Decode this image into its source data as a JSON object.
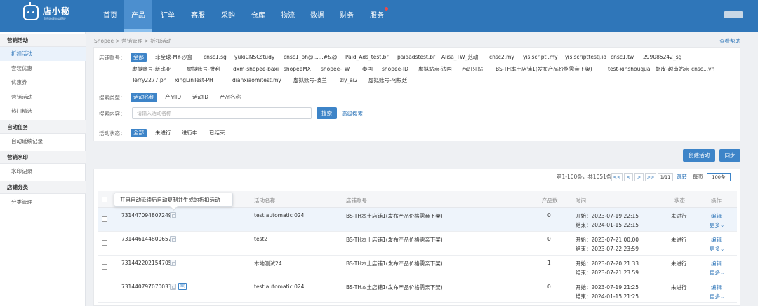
{
  "app": {
    "brand": "店小秘",
    "brand_sub": "免费跨境电商ERP",
    "user": "...."
  },
  "nav": {
    "items": [
      "首页",
      "产品",
      "订单",
      "客服",
      "采购",
      "仓库",
      "物流",
      "数据",
      "财务",
      "服务"
    ],
    "active": "产品"
  },
  "sidebar": {
    "groups": [
      {
        "title": "营销活动",
        "items": [
          "折扣活动",
          "套装优惠",
          "优惠券",
          "营销活动",
          "热门精选"
        ]
      },
      {
        "title": "自动任务",
        "items": [
          "自动延续记录"
        ]
      },
      {
        "title": "营销水印",
        "items": [
          "水印记录"
        ]
      },
      {
        "title": "店铺分类",
        "items": [
          "分类管理"
        ]
      }
    ],
    "active": "折扣活动"
  },
  "breadcrumb": "Shopee > 营销管理 > 折扣活动",
  "help": "查看帮助",
  "filters": {
    "shop_label": "店铺账号：",
    "shops_row1": [
      "全部",
      "菲全球-MY-沙盒",
      "cnsc1.sg",
      "yukiCNSCstudy",
      "cnsc1_ph@......#&@",
      "Paid_Ads_test.br",
      "paidadstest.br",
      "Alisa_TW_范动",
      "cnsc2.my",
      "yisiscripti.my",
      "yisiscripttestj.id",
      "cnsc1.tw",
      "299085242_sg"
    ],
    "shops_row2": [
      "虚拟账号-新比亚",
      "虚拟账号-誉利",
      "dxm-shopee-baxi",
      "shopeeMX",
      "shopee-TW",
      "泰国",
      "shopee-ID",
      "虚拟站点-法国",
      "西班牙站",
      "BS-TH本土店铺1(发布产品价格需亲下架)",
      "test-xinshouqua",
      "虾皮-越南站点",
      "cnsc1.vn"
    ],
    "shops_row3": [
      "Terry2277.ph",
      "xingLinTest-PH",
      "dianxiaomitest.my",
      "虚拟账号-波兰",
      "zly_ai2",
      "虚拟账号-阿根廷"
    ],
    "type_label": "搜索类型：",
    "types": [
      "活动名称",
      "产品ID",
      "活动ID",
      "产品名称"
    ],
    "content_label": "搜索内容：",
    "search_placeholder": "请输入活动名称",
    "search_button": "搜索",
    "advanced": "高级搜索",
    "status_label": "活动状态：",
    "statuses": [
      "全部",
      "未进行",
      "进行中",
      "已结束"
    ]
  },
  "actions": {
    "create": "创建活动",
    "sync": "同步"
  },
  "pager": {
    "summary": "第1-100条，共1051条",
    "prev2": "<<",
    "prev": "<",
    "next": ">",
    "next2": ">>",
    "pages": "1/11",
    "jump": "跳转",
    "per_page_label": "每页",
    "per_page": "100条"
  },
  "table": {
    "headers": [
      "活动名称",
      "店铺账号",
      "产品数",
      "时间",
      "状态",
      "操作"
    ],
    "tooltip": "开启自动延续后自动复制并生成的折扣活动",
    "rows": [
      {
        "id": "731447094807249",
        "name": "test automatic 024",
        "shop": "BS-TH本土店铺1(发布产品价格需亲下架)",
        "count": "0",
        "start": "开始：2023-07-19 22:15",
        "end": "结束：2024-01-15 22:15",
        "status": "未进行",
        "edit": "编辑",
        "more": "更多⌄"
      },
      {
        "id": "731446144800657",
        "name": "test2",
        "shop": "BS-TH本土店铺1(发布产品价格需亲下架)",
        "count": "0",
        "start": "开始：2023-07-21 00:00",
        "end": "结束：2023-07-22 23:59",
        "status": "未进行",
        "edit": "编辑",
        "more": "更多⌄"
      },
      {
        "id": "731442202154705",
        "name": "本地测试24",
        "shop": "BS-TH本土店铺1(发布产品价格需亲下架)",
        "count": "1",
        "start": "开始：2023-07-20 21:33",
        "end": "结束：2023-07-21 23:59",
        "status": "未进行",
        "edit": "编辑",
        "more": "更多⌄"
      },
      {
        "id": "731440797070033",
        "name": "test automatic 024",
        "shop": "BS-TH本土店铺1(发布产品价格需亲下架)",
        "count": "0",
        "start": "开始：2023-07-19 21:25",
        "end": "结束：2024-01-15 21:25",
        "status": "未进行",
        "edit": "编辑",
        "more": "更多⌄",
        "tag": "续"
      }
    ]
  }
}
